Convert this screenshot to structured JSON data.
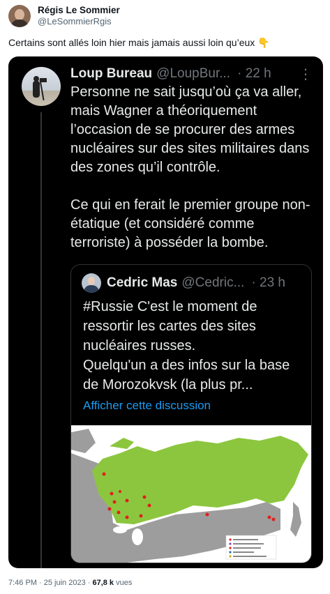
{
  "tweet": {
    "author_name": "Régis Le Sommier",
    "author_handle": "@LeSommierRgis",
    "text": "Certains sont allés loin hier mais jamais aussi loin qu’eux 👇",
    "timestamp": "7:46 PM · 25 juin 2023",
    "views_count": "67,8 k",
    "views_label": "vues"
  },
  "quoted_tweet": {
    "author_name": "Loup Bureau",
    "author_handle": "@LoupBur...",
    "separator": "·",
    "time": "22 h",
    "more_icon": "more-icon",
    "text": "Personne ne sait jusqu’où ça va aller, mais Wagner a théoriquement l’occasion de se procurer des armes nucléaires sur des sites militaires dans des zones qu’il contrôle.\n\nCe qui en ferait le premier groupe non-étatique (et considéré comme terroriste) à posséder la bombe."
  },
  "nested_tweet": {
    "author_name": "Cedric Mas",
    "author_handle": "@Cedric...",
    "separator": "·",
    "time": "23 h",
    "text": "#Russie C'est le moment de ressortir les cartes des sites nucléaires russes.\nQuelqu'un a des infos sur la base de Morozokvsk (la plus pr...",
    "link": "Afficher cette discussion"
  },
  "colors": {
    "russia_fill": "#8cc63f",
    "neighbour_fill": "#9d9d9d",
    "sea_fill": "#ffffff",
    "site_marker": "#e0201b",
    "link": "#1d9bf0"
  }
}
